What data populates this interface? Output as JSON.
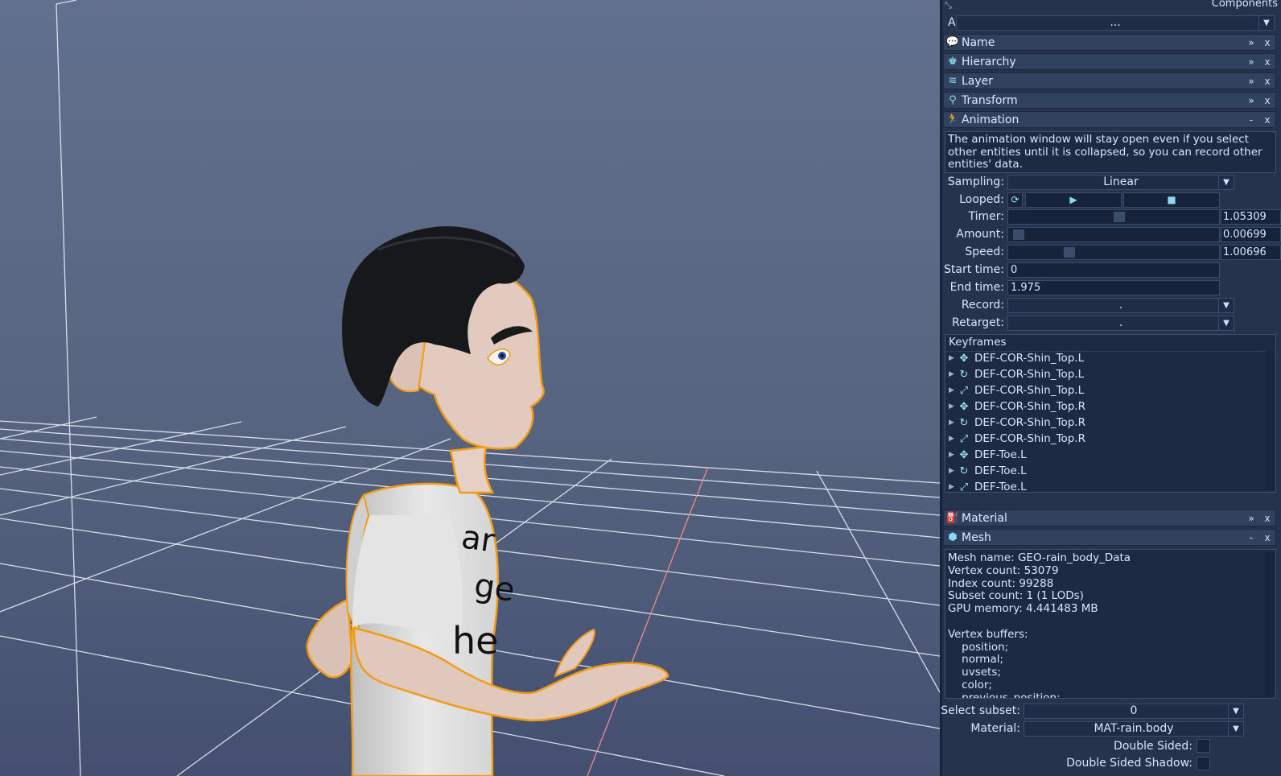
{
  "panel": {
    "title": "Components",
    "add_label": "Add:",
    "add_value": "...",
    "components": [
      {
        "name": "Name",
        "icon": "speech-bubble-icon",
        "state": "»"
      },
      {
        "name": "Hierarchy",
        "icon": "hierarchy-icon",
        "state": "»"
      },
      {
        "name": "Layer",
        "icon": "layers-icon",
        "state": "»"
      },
      {
        "name": "Transform",
        "icon": "map-pin-icon",
        "state": "»"
      },
      {
        "name": "Animation",
        "icon": "running-person-icon",
        "state": "-"
      }
    ],
    "close_symbol": "x"
  },
  "animation": {
    "info": "The animation window will stay open even if you select other entities until it is collapsed, so you can record other entities' data.",
    "sampling_label": "Sampling:",
    "sampling_value": "Linear",
    "looped_label": "Looped:",
    "timer_label": "Timer:",
    "timer_value": "1.05309",
    "timer_fraction": 0.53,
    "amount_label": "Amount:",
    "amount_value": "0.00699",
    "amount_fraction": 0.007,
    "speed_label": "Speed:",
    "speed_value": "1.00696",
    "speed_fraction": 0.27,
    "start_label": "Start time:",
    "start_value": "0",
    "end_label": "End time:",
    "end_value": "1.975",
    "record_label": "Record:",
    "record_value": ".",
    "retarget_label": "Retarget:",
    "retarget_value": ".",
    "keyframes_title": "Keyframes",
    "keyframes": [
      {
        "label": "DEF-COR-Shin_Top.L",
        "icon": "move-icon"
      },
      {
        "label": "DEF-COR-Shin_Top.L",
        "icon": "rotate-icon"
      },
      {
        "label": "DEF-COR-Shin_Top.L",
        "icon": "scale-icon"
      },
      {
        "label": "DEF-COR-Shin_Top.R",
        "icon": "move-icon"
      },
      {
        "label": "DEF-COR-Shin_Top.R",
        "icon": "rotate-icon"
      },
      {
        "label": "DEF-COR-Shin_Top.R",
        "icon": "scale-icon"
      },
      {
        "label": "DEF-Toe.L",
        "icon": "move-icon"
      },
      {
        "label": "DEF-Toe.L",
        "icon": "rotate-icon"
      },
      {
        "label": "DEF-Toe.L",
        "icon": "scale-icon"
      }
    ]
  },
  "material_header": {
    "name": "Material",
    "icon": "paint-bucket-icon",
    "state": "»"
  },
  "mesh_header": {
    "name": "Mesh",
    "icon": "cube-icon",
    "state": "-"
  },
  "mesh": {
    "info_lines": [
      "Mesh name: GEO-rain_body_Data",
      "Vertex count: 53079",
      "Index count: 99288",
      "Subset count: 1 (1 LODs)",
      "GPU memory: 4.441483 MB",
      "",
      "Vertex buffers:",
      "    position;",
      "    normal;",
      "    uvsets;",
      "    color;",
      "    previous_position;"
    ],
    "select_subset_label": "Select subset:",
    "select_subset_value": "0",
    "material_label": "Material:",
    "material_value": "MAT-rain.body",
    "double_sided_label": "Double Sided:",
    "double_sided_shadow_label": "Double Sided Shadow:"
  },
  "viewport": {
    "shirt_text": [
      "ar",
      "ge",
      "he"
    ]
  },
  "colors": {
    "accent": "#8fd7ee",
    "panel_bg": "#25334d",
    "selection_outline": "#f39c12"
  }
}
